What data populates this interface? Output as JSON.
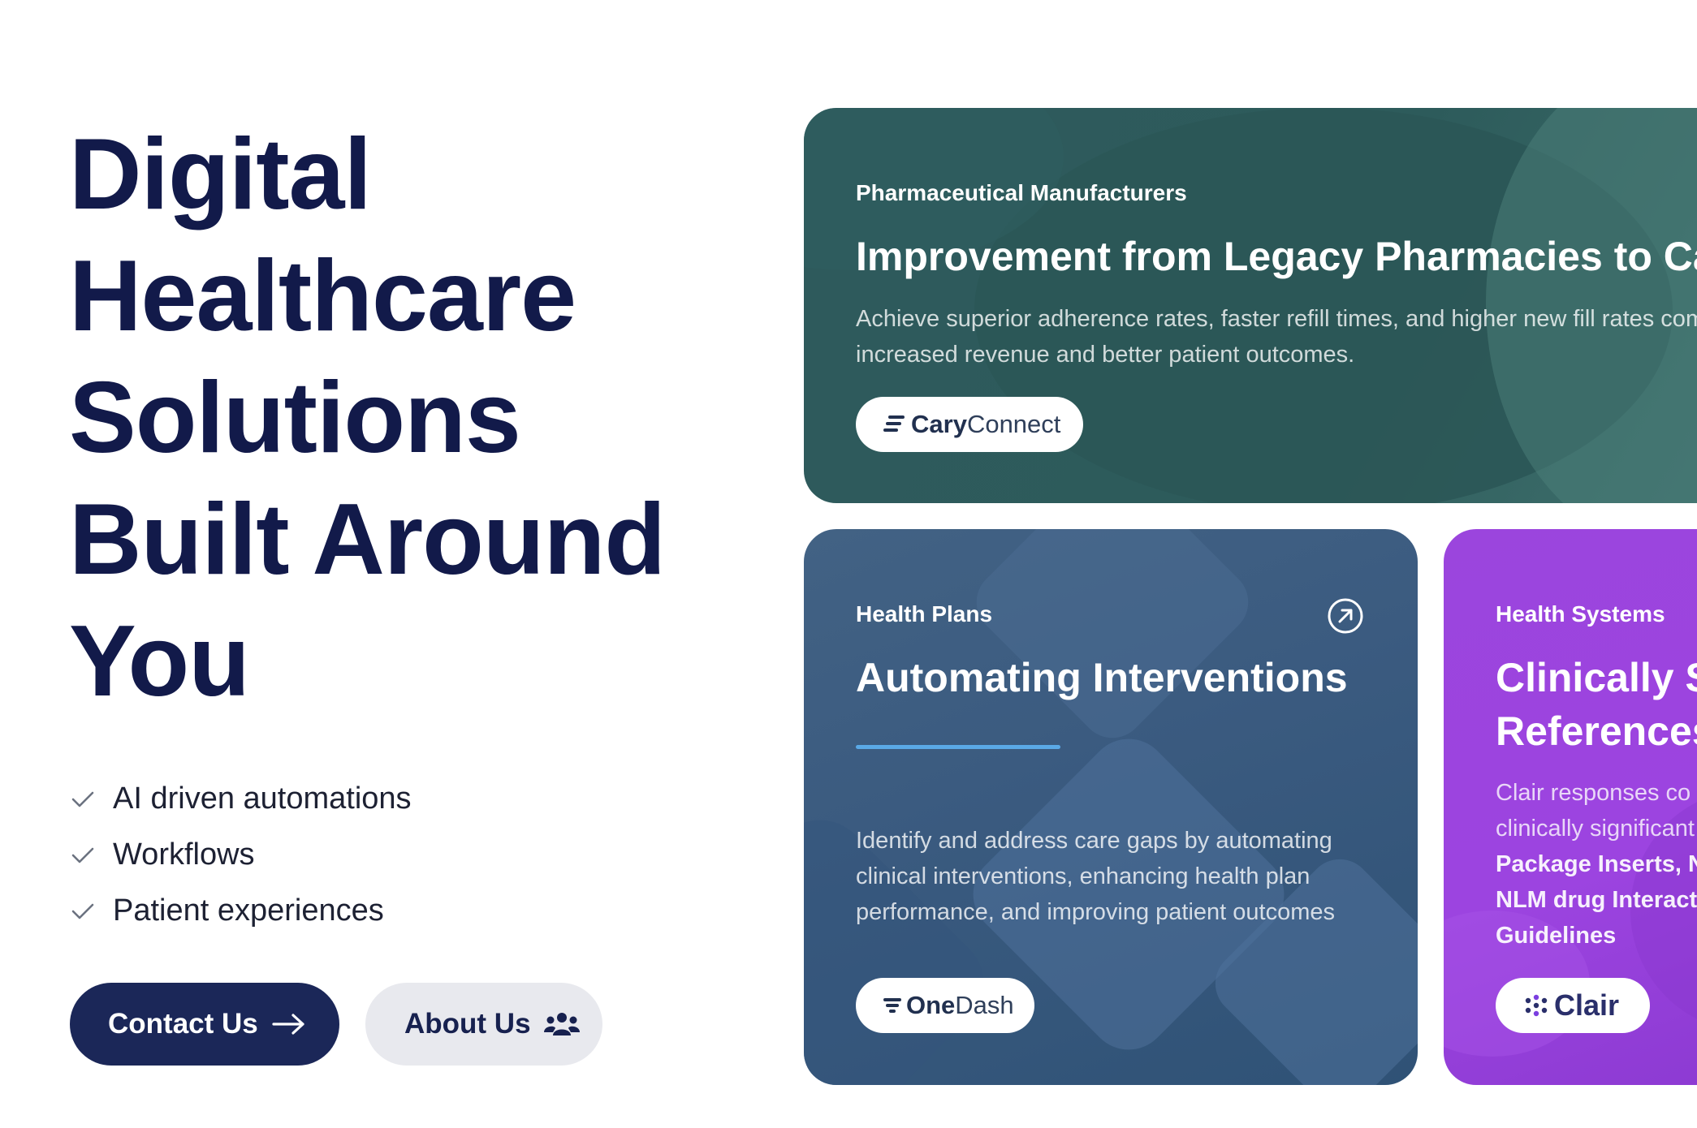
{
  "hero": {
    "title_lines": [
      "Digital",
      "Healthcare",
      "Solutions",
      "Built Around",
      "You"
    ],
    "features": [
      "AI driven automations",
      "Workflows",
      "Patient experiences"
    ],
    "contact_label": "Contact Us",
    "about_label": "About Us"
  },
  "cards": {
    "pharma": {
      "eyebrow": "Pharmaceutical Manufacturers",
      "title": "Improvement from Legacy Pharmacies to Cary",
      "desc_line1": "Achieve superior adherence rates, faster refill times, and higher new fill rates com",
      "desc_line2": "increased revenue and better patient outcomes.",
      "logo_bold": "Cary",
      "logo_light": "Connect"
    },
    "health_plans": {
      "eyebrow": "Health Plans",
      "title": "Automating Interventions",
      "desc_line1": "Identify and address care gaps by automating",
      "desc_line2": "clinical interventions, enhancing health plan",
      "desc_line3": "performance, and improving patient outcomes",
      "logo_bold": "One",
      "logo_light": "Dash"
    },
    "health_systems": {
      "eyebrow": "Health Systems",
      "title_line1": "Clinically S",
      "title_line2": "References",
      "desc_line1": "Clair responses  co",
      "desc_line2": "clinically significant",
      "desc_line3": "Package Inserts, N",
      "desc_line4": "NLM drug Interacti",
      "desc_line5": "Guidelines",
      "logo": "Clair"
    }
  },
  "colors": {
    "navy": "#121a4a",
    "pharma_card": "#2e5a5c",
    "health_plans_card": "#3b5b80",
    "health_systems_card": "#9c44e0",
    "accent_line": "#5aa9e6"
  },
  "icons": {
    "check": "check-icon",
    "contact": "arrow-right-icon",
    "about": "people-icon",
    "card_link": "arrow-up-right-circle-icon"
  }
}
